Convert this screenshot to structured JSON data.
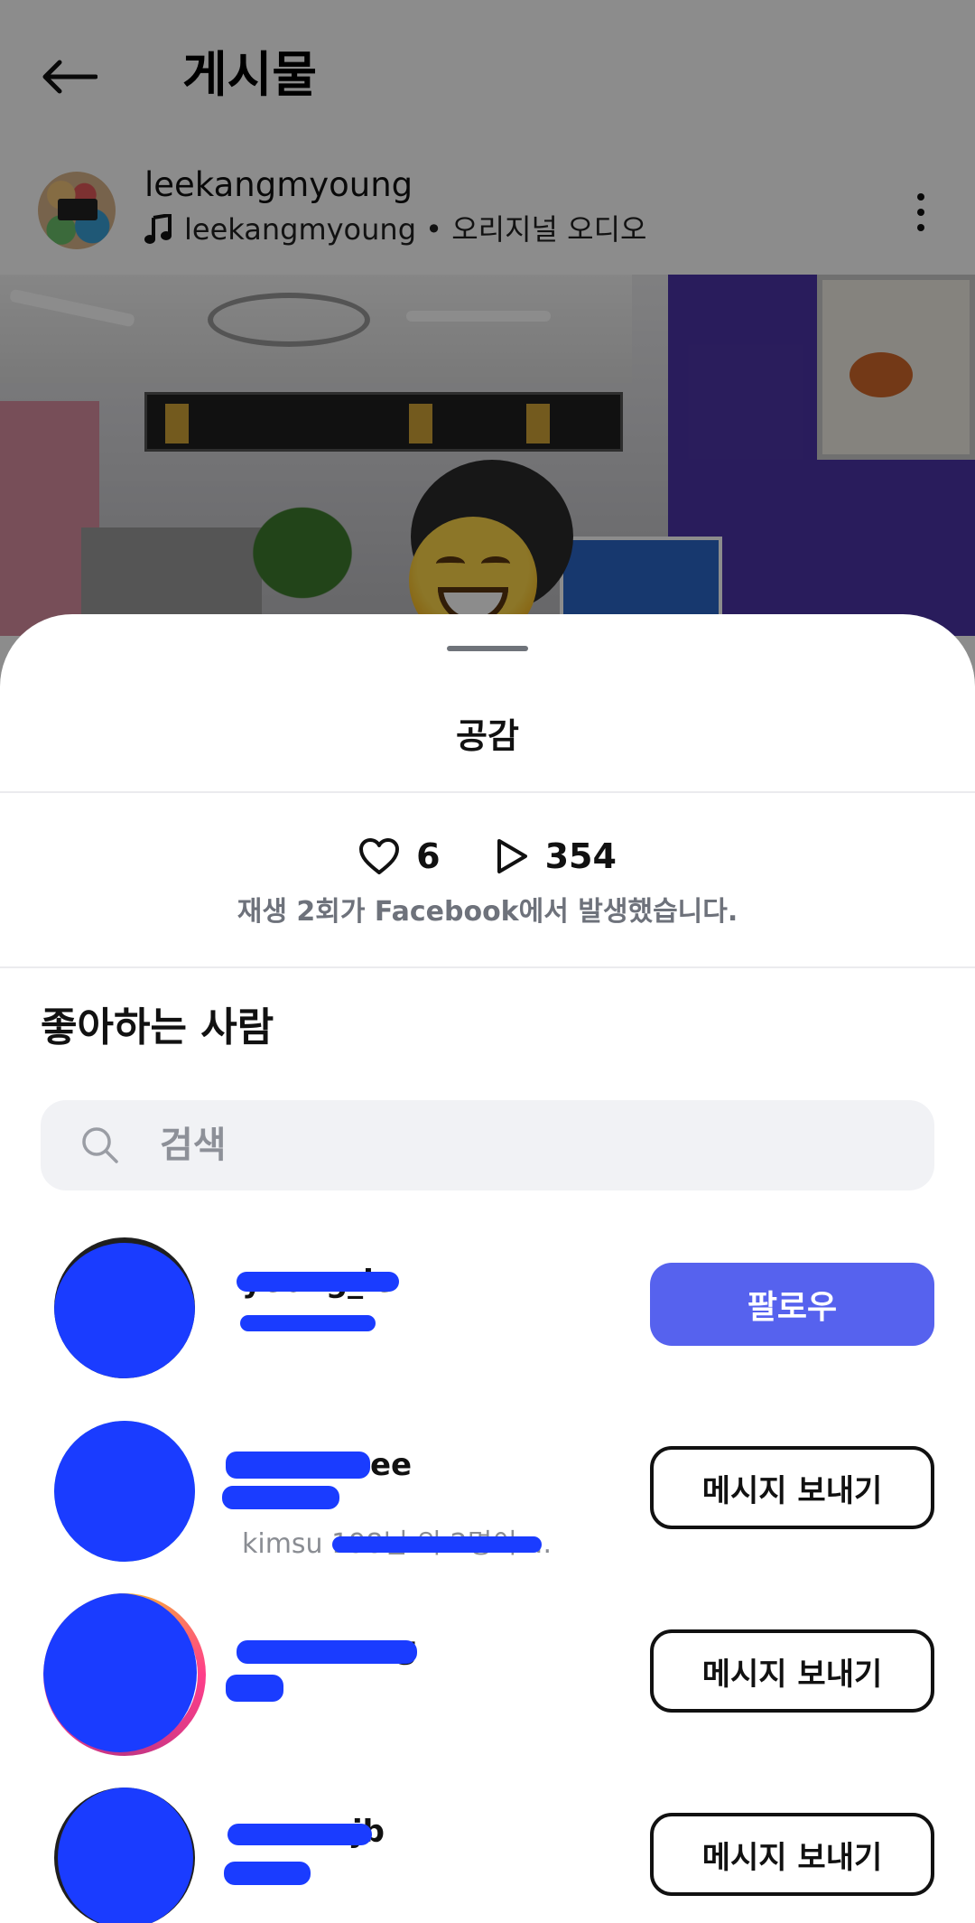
{
  "header": {
    "title": "게시물"
  },
  "post": {
    "author": "leekangmyoung",
    "audio": "leekangmyoung • 오리지널 오디오"
  },
  "sheet": {
    "title": "공감",
    "likes_count": "6",
    "plays_count": "354",
    "plays_note": "재생 2회가 Facebook에서 발생했습니다.",
    "section_title": "좋아하는 사람",
    "search": {
      "placeholder": "검색"
    }
  },
  "users": [
    {
      "name": "yeong_ie",
      "sub": "",
      "sub2": "",
      "action": "팔로우"
    },
    {
      "name": "ee",
      "sub": "",
      "sub2": "kimsu 198님 외 2명이 ...",
      "action": "메시지 보내기"
    },
    {
      "name": "g",
      "sub": "",
      "sub2": "",
      "action": "메시지 보내기"
    },
    {
      "name": "jb",
      "sub": "",
      "sub2": "",
      "action": "메시지 보내기"
    }
  ],
  "colors": {
    "follow_button": "#5662ee",
    "sheet_background": "#ffffff",
    "search_background": "#f1f2f5",
    "redaction_scribble": "#1a3cff"
  },
  "icons": {
    "back": "arrow-left-icon",
    "audio": "music-note-icon",
    "more": "more-vertical-icon",
    "like": "heart-outline-icon",
    "play": "play-outline-icon",
    "search": "search-icon"
  }
}
